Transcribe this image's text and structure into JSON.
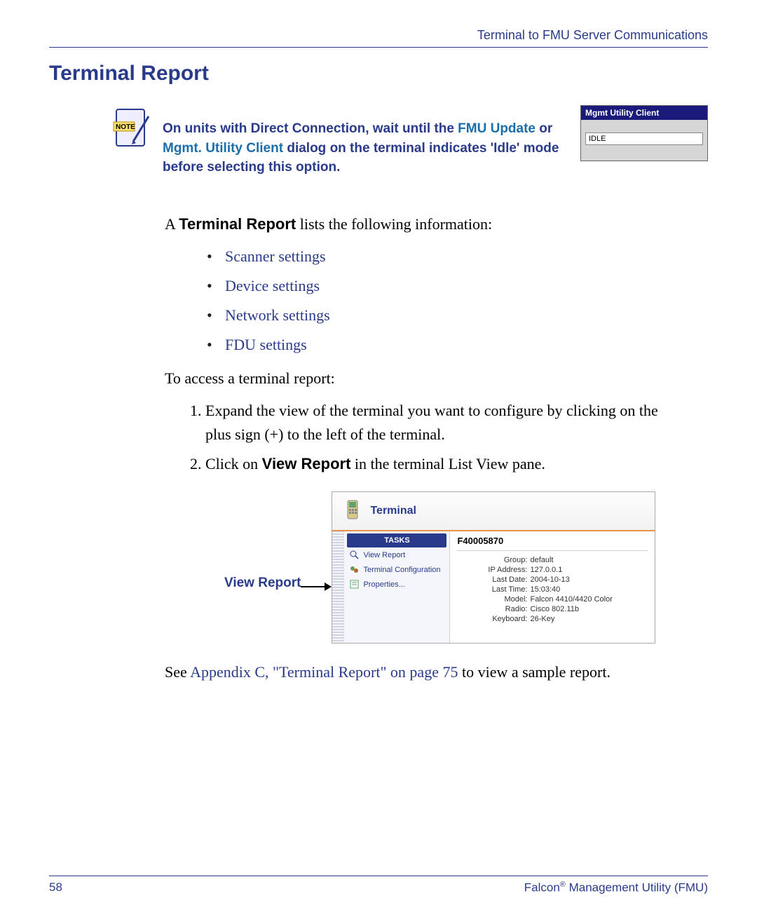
{
  "header": "Terminal to FMU Server Communications",
  "title": "Terminal Report",
  "note": {
    "part1": "On units with Direct Connection, wait until the ",
    "link1": "FMU Update",
    "part2": " or ",
    "link2": "Mgmt. Utility Client",
    "part3": " dialog on the terminal indicates 'Idle' mode before selecting this option."
  },
  "mgmt_dialog": {
    "title": "Mgmt Utility Client",
    "status": "IDLE"
  },
  "intro": {
    "prefix": "A ",
    "bold": "Terminal Report",
    "suffix": " lists the following information:"
  },
  "bullets": [
    "Scanner settings",
    "Device settings",
    "Network settings",
    "FDU settings"
  ],
  "access_line": "To access a terminal report:",
  "steps": {
    "s1": "Expand the view of the terminal you want to configure by clicking on the plus sign (+) to the left of the terminal.",
    "s2a": "Click on ",
    "s2b": "View Report",
    "s2c": " in the terminal List View pane."
  },
  "callout_label": "View Report",
  "terminal_panel": {
    "title": "Terminal",
    "tasks_header": "TASKS",
    "tasks": [
      "View Report",
      "Terminal Configuration",
      "Properties..."
    ],
    "detail_id": "F40005870",
    "details": [
      {
        "label": "Group:",
        "value": "default"
      },
      {
        "label": "IP Address:",
        "value": "127.0.0.1"
      },
      {
        "label": "Last Date:",
        "value": "2004-10-13"
      },
      {
        "label": "Last Time:",
        "value": "15:03:40"
      },
      {
        "label": "Model:",
        "value": "Falcon 4410/4420 Color"
      },
      {
        "label": "Radio:",
        "value": "Cisco 802.11b"
      },
      {
        "label": "Keyboard:",
        "value": "26-Key"
      }
    ]
  },
  "appendix": {
    "prefix": "See ",
    "link": "Appendix C, \"Terminal Report\" on page 75",
    "suffix": " to view a sample report."
  },
  "footer": {
    "page": "58",
    "product_a": "Falcon",
    "product_b": " Management Utility (FMU)"
  }
}
